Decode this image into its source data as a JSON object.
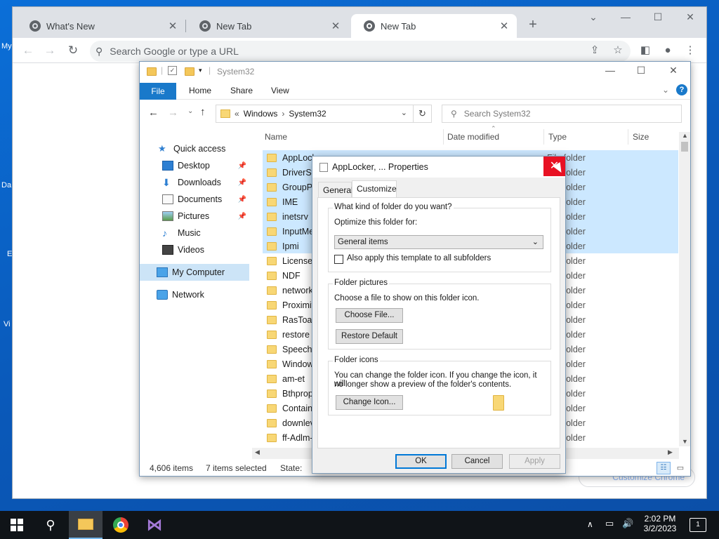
{
  "desktop": {
    "icons": [
      "My",
      "Da",
      "E",
      "Vi"
    ]
  },
  "browser": {
    "tabs": [
      {
        "title": "What's New",
        "active": false
      },
      {
        "title": "New Tab",
        "active": false
      },
      {
        "title": "New Tab",
        "active": true
      }
    ],
    "omnibox_placeholder": "Search Google or type a URL",
    "customize_label": "Customize Chrome"
  },
  "explorer": {
    "title": "System32",
    "ribbon_tabs": [
      "File",
      "Home",
      "Share",
      "View"
    ],
    "breadcrumb": [
      "«",
      "Windows",
      "›",
      "System32"
    ],
    "search_placeholder": "Search System32",
    "nav": [
      {
        "label": "Quick access",
        "icon": "star-icon"
      },
      {
        "label": "Desktop",
        "icon": "desktop-icon",
        "pinned": true
      },
      {
        "label": "Downloads",
        "icon": "download-icon",
        "pinned": true
      },
      {
        "label": "Documents",
        "icon": "document-icon",
        "pinned": true
      },
      {
        "label": "Pictures",
        "icon": "picture-icon",
        "pinned": true
      },
      {
        "label": "Music",
        "icon": "music-icon"
      },
      {
        "label": "Videos",
        "icon": "video-icon"
      },
      {
        "label": "My Computer",
        "icon": "computer-icon",
        "selected": true
      },
      {
        "label": "Network",
        "icon": "network-icon"
      }
    ],
    "columns": [
      "Name",
      "Date modified",
      "Type",
      "Size"
    ],
    "files": [
      {
        "name": "AppLocker",
        "type": "File folder",
        "selected": true
      },
      {
        "name": "DriverStore",
        "type": "File folder",
        "selected": true
      },
      {
        "name": "GroupPolicy",
        "type": "File folder",
        "selected": true
      },
      {
        "name": "IME",
        "type": "File folder",
        "selected": true
      },
      {
        "name": "inetsrv",
        "type": "File folder",
        "selected": true
      },
      {
        "name": "InputMethod",
        "type": "File folder",
        "selected": true
      },
      {
        "name": "Ipmi",
        "type": "File folder",
        "selected": true
      },
      {
        "name": "Licenses",
        "type": "File folder",
        "selected": false
      },
      {
        "name": "NDF",
        "type": "File folder",
        "selected": false
      },
      {
        "name": "networklist",
        "type": "File folder",
        "selected": false
      },
      {
        "name": "Proximity",
        "type": "File folder",
        "selected": false
      },
      {
        "name": "RasToast",
        "type": "File folder",
        "selected": false
      },
      {
        "name": "restore",
        "type": "File folder",
        "selected": false
      },
      {
        "name": "Speech",
        "type": "File folder",
        "selected": false
      },
      {
        "name": "WindowsPowerShell",
        "type": "File folder",
        "selected": false
      },
      {
        "name": "am-et",
        "type": "File folder",
        "selected": false
      },
      {
        "name": "Bthprops",
        "type": "File folder",
        "selected": false
      },
      {
        "name": "Containers",
        "type": "File folder",
        "selected": false
      },
      {
        "name": "downlevel",
        "type": "File folder",
        "selected": false
      },
      {
        "name": "ff-Adlm-SN",
        "type": "File folder",
        "selected": false
      }
    ],
    "status": {
      "items": "4,606 items",
      "selected": "7 items selected",
      "state": "State:"
    }
  },
  "dialog": {
    "title": "AppLocker, ... Properties",
    "tabs": [
      "General",
      "Customize"
    ],
    "active_tab": "Customize",
    "kind_group": "What kind of folder do you want?",
    "optimize_label": "Optimize this folder for:",
    "optimize_value": "General items",
    "apply_subfolders": "Also apply this template to all subfolders",
    "pictures_group": "Folder pictures",
    "pictures_text": "Choose a file to show on this folder icon.",
    "choose_file": "Choose File...",
    "restore_default": "Restore Default",
    "icons_group": "Folder icons",
    "icons_text_1": "You can change the folder icon. If you change the icon, it will",
    "icons_text_2": "no longer show a preview of the folder's contents.",
    "change_icon": "Change Icon...",
    "ok": "OK",
    "cancel": "Cancel",
    "apply": "Apply"
  },
  "taskbar": {
    "time": "2:02 PM",
    "date": "3/2/2023",
    "notification_count": "1"
  }
}
